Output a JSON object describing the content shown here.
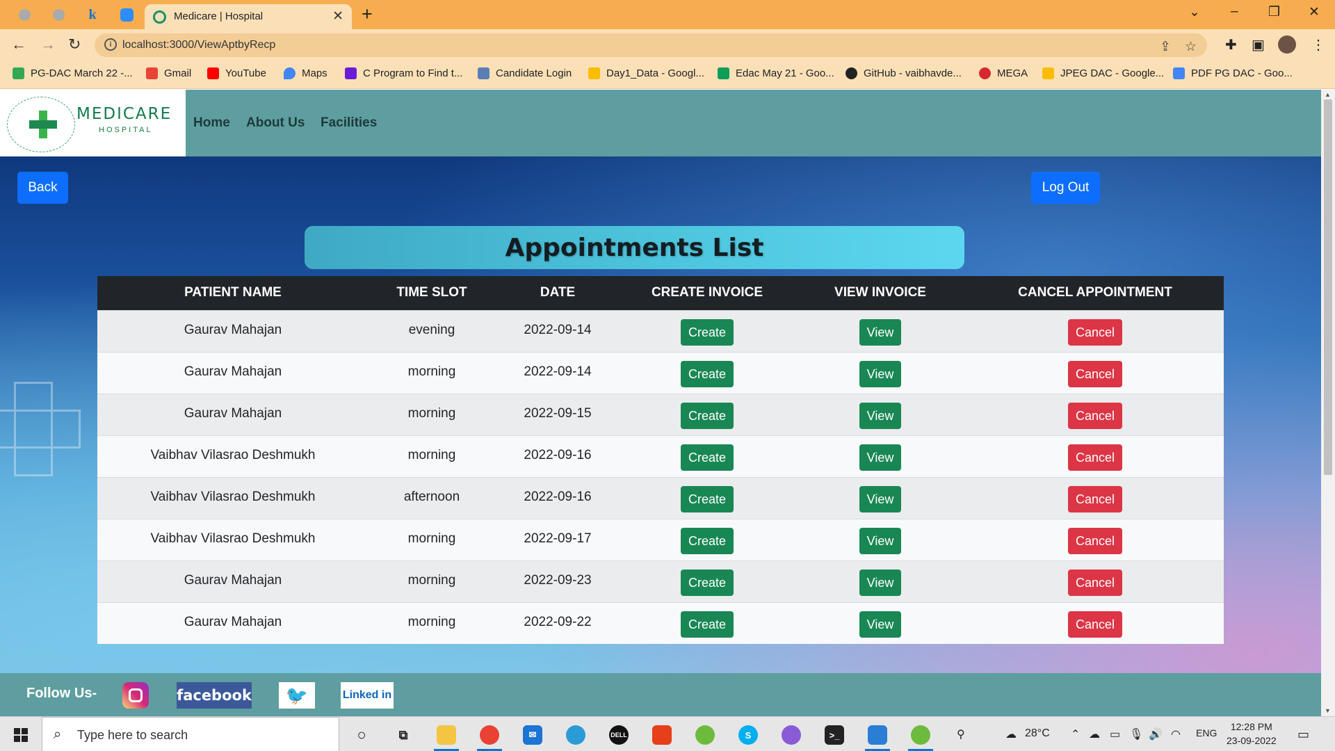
{
  "browser": {
    "active_tab_title": "Medicare | Hospital",
    "url": "localhost:3000/ViewAptbyRecp",
    "bookmarks": [
      "PG-DAC March 22 -...",
      "Gmail",
      "YouTube",
      "Maps",
      "C Program to Find t...",
      "Candidate Login",
      "Day1_Data - Googl...",
      "Edac May 21 - Goo...",
      "GitHub - vaibhavde...",
      "MEGA",
      "JPEG DAC - Google...",
      "PDF PG DAC - Goo..."
    ]
  },
  "site": {
    "logo_name": "MEDICARE",
    "logo_sub": "HOSPITAL",
    "nav": [
      "Home",
      "About Us",
      "Facilities"
    ],
    "back_label": "Back",
    "logout_label": "Log Out",
    "page_title": "Appointments List"
  },
  "table": {
    "headers": [
      "PATIENT NAME",
      "TIME SLOT",
      "DATE",
      "CREATE INVOICE",
      "VIEW INVOICE",
      "CANCEL APPOINTMENT"
    ],
    "create_label": "Create",
    "view_label": "View",
    "cancel_label": "Cancel",
    "rows": [
      {
        "name": "Gaurav Mahajan",
        "slot": "evening",
        "date": "2022-09-14"
      },
      {
        "name": "Gaurav Mahajan",
        "slot": "morning",
        "date": "2022-09-14"
      },
      {
        "name": "Gaurav Mahajan",
        "slot": "morning",
        "date": "2022-09-15"
      },
      {
        "name": "Vaibhav Vilasrao Deshmukh",
        "slot": "morning",
        "date": "2022-09-16"
      },
      {
        "name": "Vaibhav Vilasrao Deshmukh",
        "slot": "afternoon",
        "date": "2022-09-16"
      },
      {
        "name": "Vaibhav Vilasrao Deshmukh",
        "slot": "morning",
        "date": "2022-09-17"
      },
      {
        "name": "Gaurav Mahajan",
        "slot": "morning",
        "date": "2022-09-23"
      },
      {
        "name": "Gaurav Mahajan",
        "slot": "morning",
        "date": "2022-09-22"
      }
    ]
  },
  "footer": {
    "follow_label": "Follow Us-",
    "facebook": "facebook",
    "linkedin": "Linked in"
  },
  "taskbar": {
    "search_placeholder": "Type here to search",
    "weather": "28°C",
    "lang": "ENG",
    "time": "12:28 PM",
    "date": "23-09-2022"
  },
  "colors": {
    "accent_blue": "#0d6efd",
    "success_green": "#198754",
    "danger_red": "#dc3545",
    "navbar_teal": "#5e9ea0",
    "tab_orange": "#f7ad4f"
  }
}
